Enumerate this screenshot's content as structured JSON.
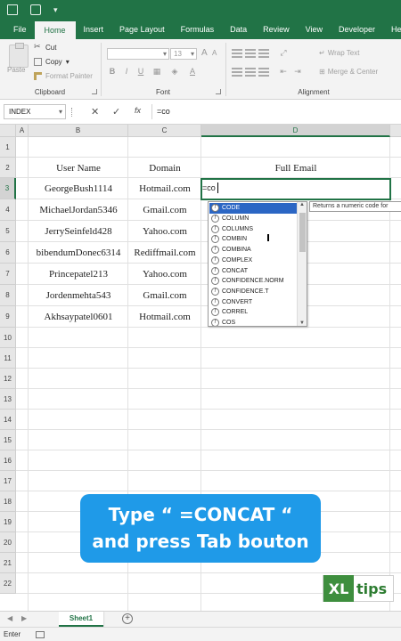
{
  "ribbon": {
    "tabs": [
      "File",
      "Home",
      "Insert",
      "Page Layout",
      "Formulas",
      "Data",
      "Review",
      "View",
      "Developer",
      "Help"
    ],
    "active_tab": "Home",
    "clipboard": {
      "paste": "Paste",
      "cut": "Cut",
      "copy": "Copy",
      "copy_arrow": "▾",
      "format_painter": "Format Painter",
      "label": "Clipboard"
    },
    "font": {
      "size": "13",
      "bold": "B",
      "italic": "I",
      "underline": "U",
      "grow": "A",
      "shrink": "A",
      "label": "Font"
    },
    "alignment": {
      "wrap_text": "Wrap Text",
      "merge_center": "Merge & Center",
      "label": "Alignment"
    }
  },
  "formula_bar": {
    "name_box": "INDEX",
    "cancel": "✕",
    "enter": "✓",
    "fx": "fx",
    "value": "=co"
  },
  "columns": [
    "A",
    "B",
    "C",
    "D"
  ],
  "rows": [
    "1",
    "2",
    "3",
    "4",
    "5",
    "6",
    "7",
    "8",
    "9",
    "10",
    "11",
    "12",
    "13",
    "14",
    "15",
    "16",
    "17",
    "18",
    "19",
    "20",
    "21",
    "22"
  ],
  "headers": {
    "user_name": "User Name",
    "domain": "Domain",
    "full_email": "Full Email"
  },
  "table": [
    {
      "user": "GeorgeBush1114",
      "domain": "Hotmail.com"
    },
    {
      "user": "MichaelJordan5346",
      "domain": "Gmail.com"
    },
    {
      "user": "JerrySeinfeld428",
      "domain": "Yahoo.com"
    },
    {
      "user": "bibendumDonec6314",
      "domain": "Rediffmail.com"
    },
    {
      "user": "Princepatel213",
      "domain": "Yahoo.com"
    },
    {
      "user": "Jordenmehta543",
      "domain": "Gmail.com"
    },
    {
      "user": "Akhsaypatel0601",
      "domain": "Hotmail.com"
    }
  ],
  "active_cell_text": "=co",
  "autocomplete": {
    "items": [
      "CODE",
      "COLUMN",
      "COLUMNS",
      "COMBIN",
      "COMBINA",
      "COMPLEX",
      "CONCAT",
      "CONFIDENCE.NORM",
      "CONFIDENCE.T",
      "CONVERT",
      "CORREL",
      "COS"
    ],
    "selected": "CODE",
    "tooltip": "Returns a numeric code for"
  },
  "banner": {
    "line1": "Type “ =CONCAT “",
    "line2": "and press Tab bouton"
  },
  "logo": {
    "xl": "XL",
    "tips": "tips"
  },
  "sheet": {
    "tab": "Sheet1",
    "add": "+"
  },
  "status": {
    "mode": "Enter"
  },
  "colors": {
    "excel_green": "#217346",
    "selection_blue": "#2b66c4",
    "banner_blue": "#1f9ae8",
    "logo_green": "#3e8e3e"
  }
}
